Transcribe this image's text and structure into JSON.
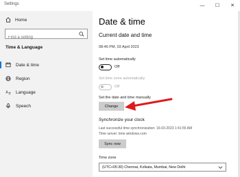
{
  "window": {
    "title": "Settings",
    "controls": {
      "minimize": "—",
      "maximize": "☐",
      "close": "✕"
    }
  },
  "sidebar": {
    "home_label": "Home",
    "search_placeholder": "Find a setting",
    "section_title": "Time & Language",
    "items": [
      {
        "label": "Date & time",
        "icon": "clock-calendar-icon",
        "active": true
      },
      {
        "label": "Region",
        "icon": "globe-icon",
        "active": false
      },
      {
        "label": "Language",
        "icon": "language-icon",
        "active": false
      },
      {
        "label": "Speech",
        "icon": "microphone-icon",
        "active": false
      }
    ]
  },
  "main": {
    "title": "Date & time",
    "section_title": "Current date and time",
    "current_datetime": "08:46 PM, 03 April 2023",
    "set_time_auto": {
      "label": "Set time automatically",
      "state": "Off"
    },
    "set_zone_auto": {
      "label": "Set time zone automatically",
      "state": "Off"
    },
    "manual": {
      "label": "Set the date and time manually",
      "button": "Change"
    },
    "sync": {
      "title": "Synchronize your clock",
      "last_sync": "Last successful time synchronization: 16-03-2023 1:41:55 AM",
      "server": "Time server: time.windows.com",
      "button": "Sync now"
    },
    "timezone": {
      "label": "Time zone",
      "value": "(UTC+05:30) Chennai, Kolkata, Mumbai, New Delhi"
    }
  },
  "colors": {
    "accent": "#0078d7",
    "annotation_arrow": "#e0191c",
    "sidebar_bg": "#f2f2f2"
  }
}
